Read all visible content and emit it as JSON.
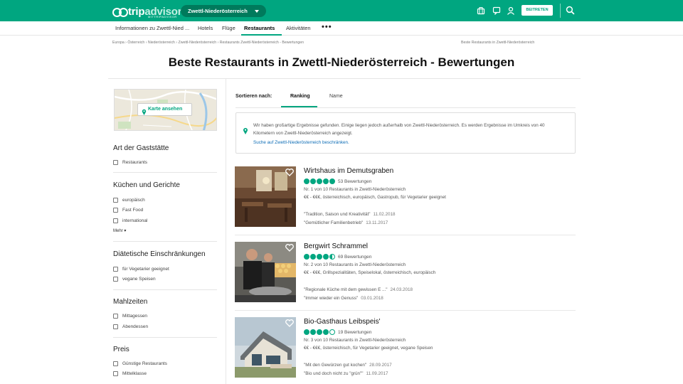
{
  "header": {
    "logo_trip": "trip",
    "logo_advisor": "advisor",
    "logo_sub": "MITTRIPADVISOR",
    "geo_label": "Zwettl-Niederösterreich",
    "join_label": "BEITRETEN",
    "brand_color": "#00a680",
    "icons": [
      "suitcase-icon",
      "notification-icon",
      "profile-icon",
      "search-icon"
    ]
  },
  "nav": {
    "items": [
      "Informationen zu Zwettl-Nied ...",
      "Hotels",
      "Flüge",
      "Restaurants",
      "Aktivitäten"
    ],
    "active": "Restaurants",
    "more": "•••"
  },
  "breadcrumb": {
    "path": "Europa  ›  Österreich  ›  Niederösterreich  ›  Zwettl-Niederösterreich  ›  Restaurants Zwettl-Niederösterreich - Bewertungen",
    "right": "Beste Restaurants in Zwettl-Niederösterreich"
  },
  "page_title": "Beste Restaurants in Zwettl-Niederösterreich - Bewertungen",
  "map": {
    "button_label": "Karte ansehen"
  },
  "filters": {
    "type": {
      "title": "Art der Gaststätte",
      "options": [
        "Restaurants"
      ]
    },
    "cuisine": {
      "title": "Küchen und Gerichte",
      "options": [
        "europäisch",
        "Fast Food",
        "international"
      ],
      "more": "Mehr ▾"
    },
    "diet": {
      "title": "Diätetische Einschränkungen",
      "options": [
        "für Vegetarier geeignet",
        "vegane Speisen"
      ]
    },
    "meals": {
      "title": "Mahlzeiten",
      "options": [
        "Mittagessen",
        "Abendessen"
      ]
    },
    "price": {
      "title": "Preis",
      "options": [
        "Günstige Restaurants",
        "Mittelklasse"
      ]
    }
  },
  "sort": {
    "label": "Sortieren nach:",
    "tabs": [
      "Ranking",
      "Name"
    ],
    "active": "Ranking"
  },
  "notice": {
    "text": "Wir haben großartige Ergebnisse gefunden. Einige liegen jedoch außerhalb von Zwettl-Niederösterreich. Es werden Ergebnisse im Umkreis von 40 Kilometern von Zwettl-Niederösterreich angezeigt.",
    "link": "Suche auf Zwettl-Niederösterreich beschränken."
  },
  "restaurants": [
    {
      "name": "Wirtshaus im Demutsgraben",
      "rating": 5,
      "reviews": "53 Bewertungen",
      "rank": "Nr. 1 von 10 Restaurants in Zwettl-Niederösterreich",
      "cuisine": "€€ - €€€, österreichisch, europäisch, Gastropub, für Vegetarier geeignet",
      "review1": "\"Tradition, Saison und Kreativität\"",
      "date1": "11.02.2018",
      "review2": "\"Gemütlicher Familienbetrieb\"",
      "date2": "13.11.2017"
    },
    {
      "name": "Bergwirt Schrammel",
      "rating": 4.5,
      "reviews": "69 Bewertungen",
      "rank": "Nr. 2 von 10 Restaurants in Zwettl-Niederösterreich",
      "cuisine": "€€ - €€€, Grillspezialitäten, Speiselokal, österreichisch, europäisch",
      "review1": "\"Regionale Küche mit dem gewissen E ...\"",
      "date1": "24.03.2018",
      "review2": "\"Immer wieder ein Genuss\"",
      "date2": "03.01.2018"
    },
    {
      "name": "Bio-Gasthaus Leibspeis'",
      "rating": 4,
      "reviews": "19 Bewertungen",
      "rank": "Nr. 3 von 10 Restaurants in Zwettl-Niederösterreich",
      "cuisine": "€€ - €€€, österreichisch, für Vegetarier geeignet, vegane Speisen",
      "review1": "\"Mit den Gewürzen gut kochen\"",
      "date1": "28.09.2017",
      "review2": "\"Bio und doch nicht zu \"grün\"\"",
      "date2": "11.09.2017"
    }
  ]
}
